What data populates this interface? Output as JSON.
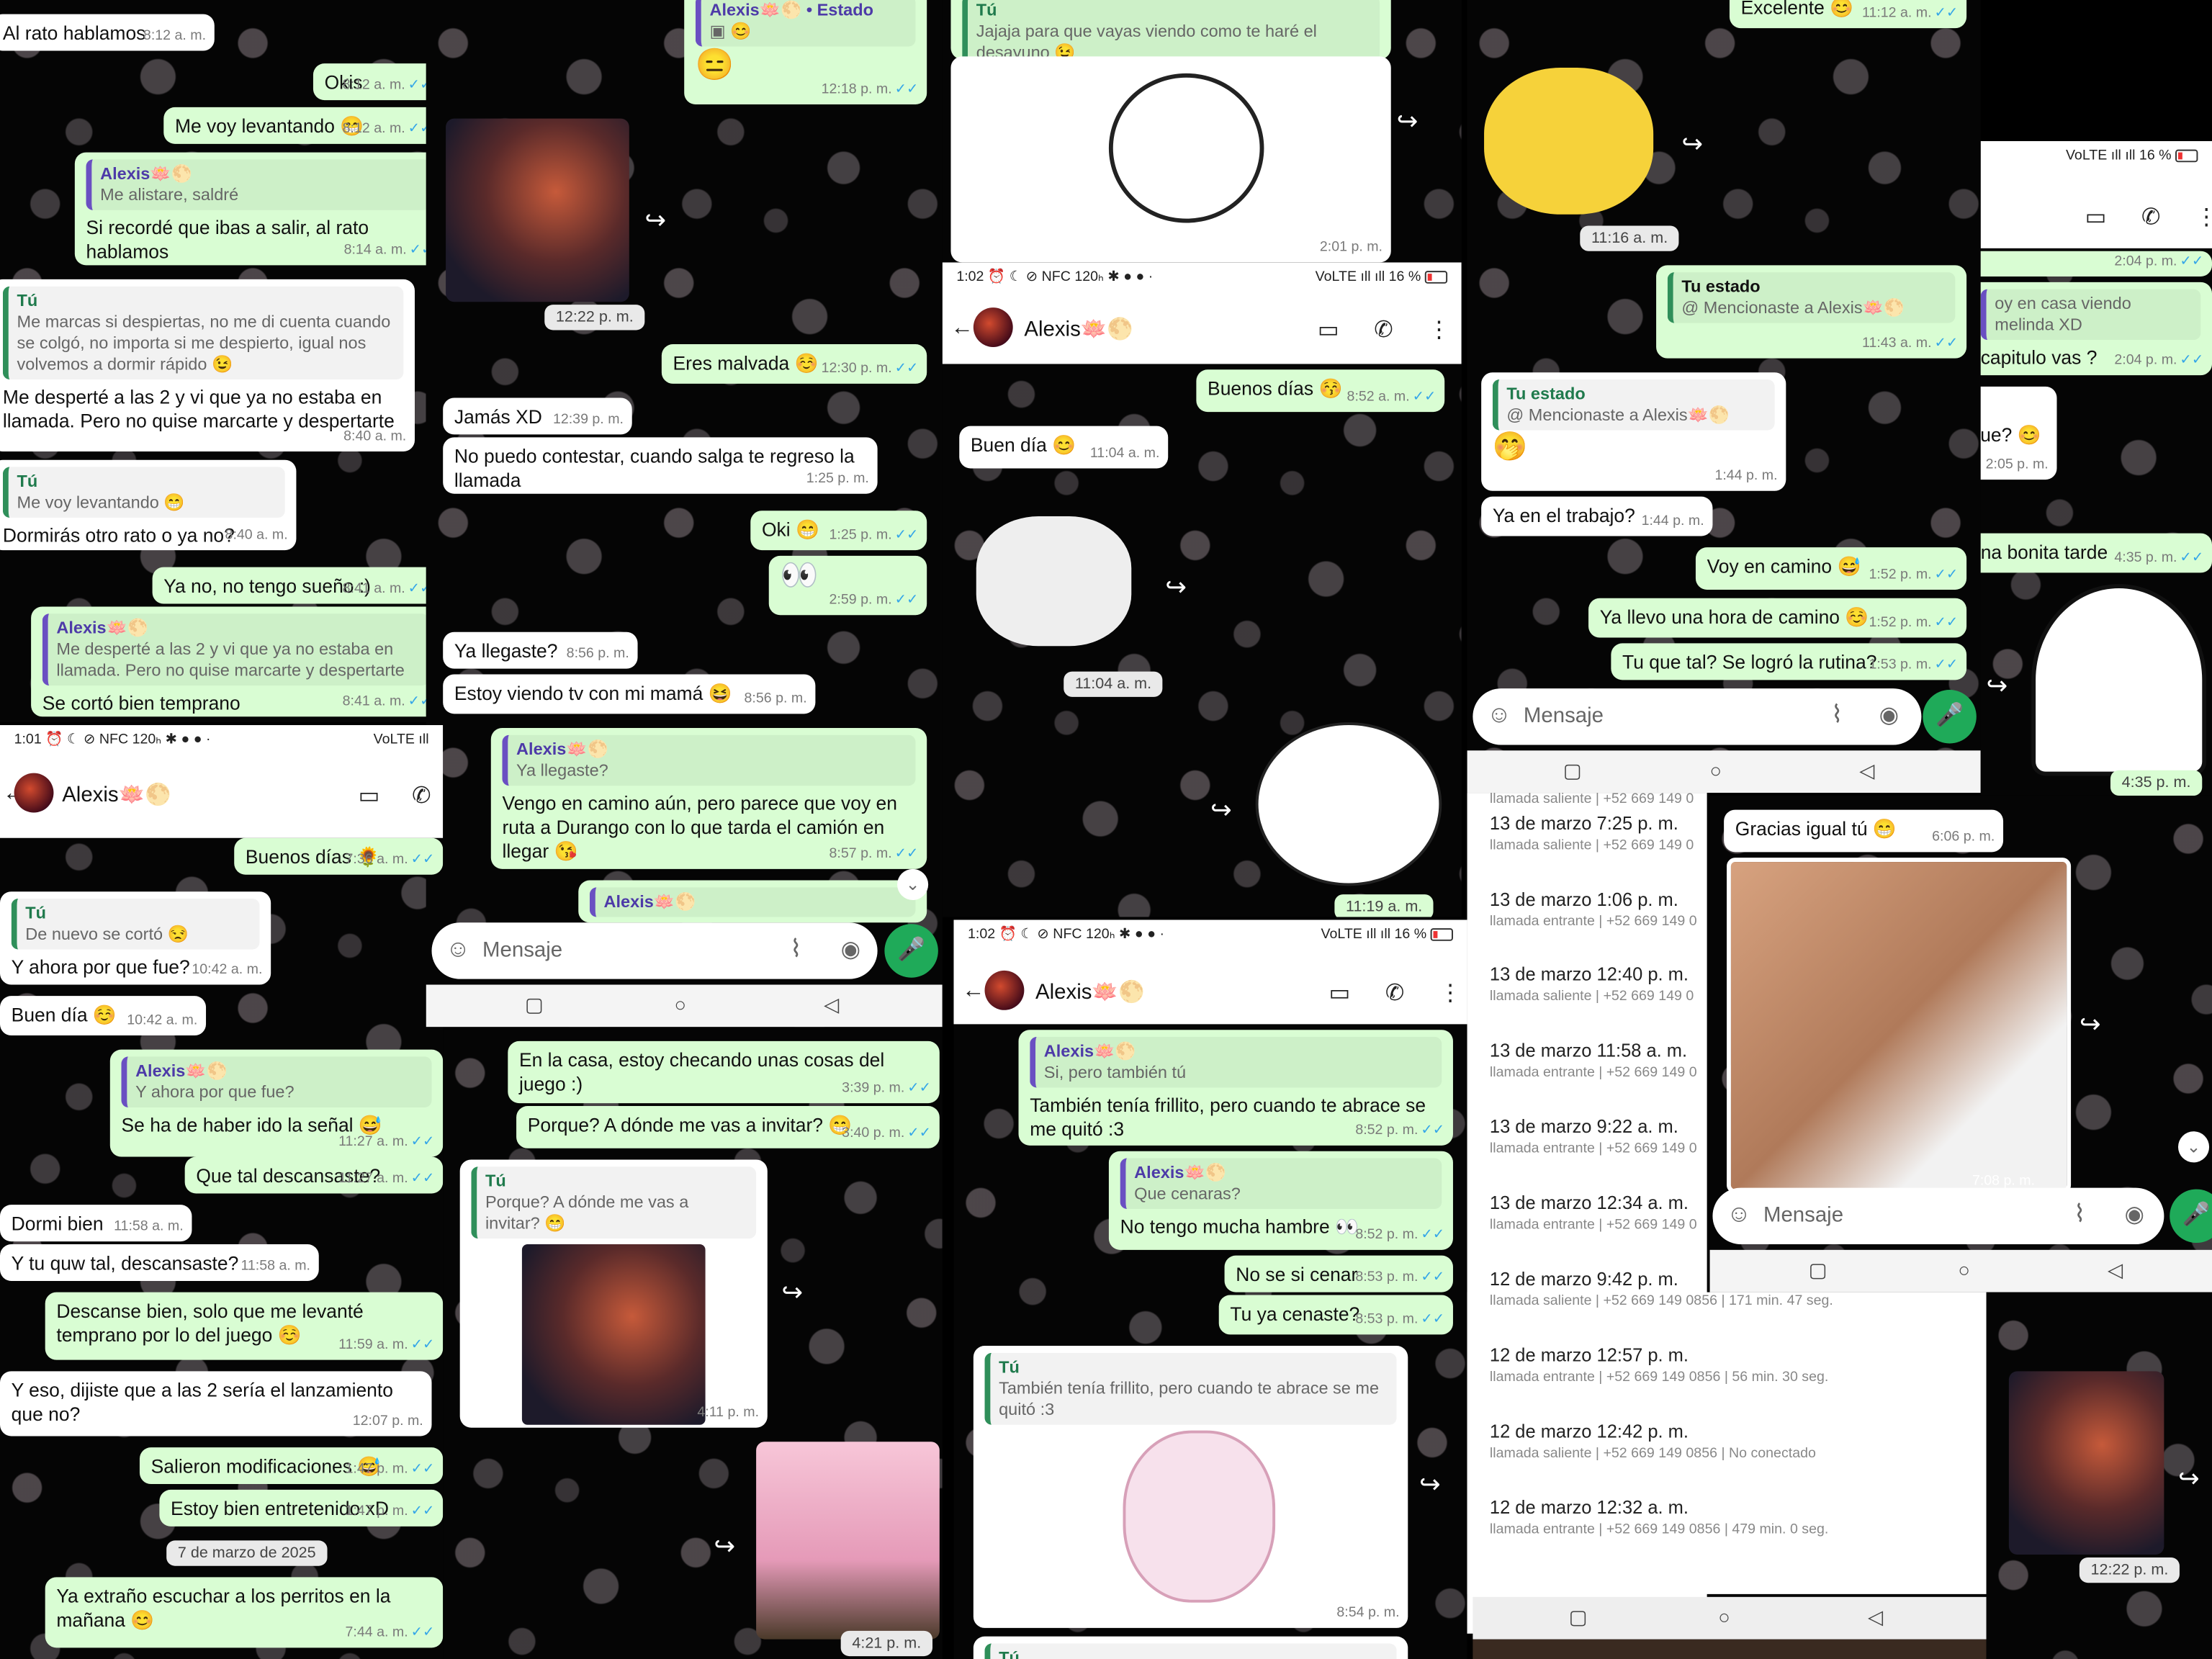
{
  "common": {
    "contact_name": "Alexis🪷🌕",
    "you_label": "Tú",
    "input_placeholder": "Mensaje",
    "status_label": "Tu estado",
    "mention_text": "@ Mencionaste a Alexis🪷🌕",
    "alexis_status_label": "Alexis🪷🌕 • Estado"
  },
  "status_bar": {
    "time_1": "1:01",
    "time_2": "1:02",
    "time_3": "1:02",
    "icons": "⏰ ☾ ⊘ NFC 120ₕ ✱ ● ● ·",
    "right": "VoLTE ıll ıll 16 %",
    "right_short": "VoLTE ıll"
  },
  "col1": {
    "m1": {
      "text": "Al rato hablamos",
      "time": "8:12 a. m."
    },
    "m2": {
      "text": "Okis",
      "time": "8:12 a. m."
    },
    "m3": {
      "text": "Me voy levantando 😁",
      "time": "8:12 a. m."
    },
    "m4": {
      "qname": "Alexis🪷🌕",
      "qtext": "Me alistare, saldré",
      "text": "Si recordé que ibas a salir, al rato hablamos",
      "time": "8:14 a. m."
    },
    "m5": {
      "qname": "Tú",
      "qtext": "Me marcas si despiertas, no me di cuenta cuando se colgó, no importa si me despierto, igual nos volvemos a dormir rápido 😉",
      "text": "Me desperté a las 2 y vi que ya no estaba en llamada. Pero no quise marcarte y despertarte",
      "time": "8:40 a. m."
    },
    "m6": {
      "qname": "Tú",
      "qtext": "Me voy levantando 😁",
      "text": "Dormirás otro rato o ya no?",
      "time": "8:40 a. m."
    },
    "m7": {
      "text": "Ya no, no tengo sueño :)",
      "time": "8:41 a. m."
    },
    "m8": {
      "qname": "Alexis🪷🌕",
      "qtext": "Me desperté a las 2 y vi que ya no estaba en llamada. Pero no quise marcarte y despertarte",
      "text": "Se cortó bien temprano",
      "time": "8:41 a. m."
    },
    "m9": {
      "text": "Buenos días 🌻",
      "time": "7:36 a. m."
    },
    "m10": {
      "qname": "Tú",
      "qtext": "De nuevo se cortó 😒",
      "text": "Y ahora por que fue?",
      "time": "10:42 a. m."
    },
    "m11": {
      "text": "Buen día ☺️",
      "time": "10:42 a. m."
    },
    "m12": {
      "qname": "Alexis🪷🌕",
      "qtext": "Y ahora por que fue?",
      "text": "Se ha de haber ido la señal 😅",
      "time": "11:27 a. m."
    },
    "m13": {
      "text": "Que tal descansaste?",
      "time": "11:27 a. m."
    },
    "m14": {
      "text": "Dormi bien",
      "time": "11:58 a. m."
    },
    "m15": {
      "text": "Y tu quw tal, descansaste?",
      "time": "11:58 a. m."
    },
    "m16": {
      "text": "Descanse bien, solo que me levanté temprano por lo del juego ☺️",
      "time": "11:59 a. m."
    },
    "m17": {
      "text": "Y eso, dijiste que a las 2 sería el lanzamiento que no?",
      "time": "12:07 p. m."
    },
    "m18": {
      "text": "Salieron modificaciones 😅",
      "time": "1:47 p. m."
    },
    "m19": {
      "text": "Estoy bien entretenido xD",
      "time": "1:47 p. m."
    },
    "date_chip": "7 de marzo de 2025",
    "m20": {
      "text": "Ya extraño escuchar a los perritos en la mañana 😊",
      "time": "7:44 a. m."
    }
  },
  "col2": {
    "top_time": "12:18 p. m.",
    "img_time": "12:22 p. m.",
    "m1": {
      "text": "Eres malvada ☺️",
      "time": "12:30 p. m."
    },
    "m2": {
      "text": "Jamás XD",
      "time": "12:39 p. m."
    },
    "m3": {
      "text": "No puedo contestar, cuando salga te regreso la llamada",
      "time": "1:25 p. m."
    },
    "m4": {
      "text": "Oki 😁",
      "time": "1:25 p. m."
    },
    "m5": {
      "text": "👀",
      "time": "2:59 p. m."
    },
    "m6": {
      "text": "Ya llegaste?",
      "time": "8:56 p. m."
    },
    "m7": {
      "text": "Estoy viendo tv con mi mamá 😆",
      "time": "8:56 p. m."
    },
    "m8": {
      "qname": "Alexis🪷🌕",
      "qtext": "Ya llegaste?",
      "text": "Vengo en camino aún, pero parece que voy en ruta a Durango con lo que tarda el camión en llegar 😘",
      "time": "8:57 p. m."
    },
    "m9": {
      "text": "En la casa, estoy checando unas cosas del juego :)",
      "time": "3:39 p. m."
    },
    "m10": {
      "text": "Porque? A dónde me vas a invitar? 😁",
      "time": "3:40 p. m."
    },
    "m11": {
      "qname": "Tú",
      "qtext": "Porque? A dónde me vas a invitar? 😁",
      "time": "4:11 p. m."
    },
    "m12_time": "4:21 p. m."
  },
  "col3": {
    "m1": {
      "qname": "Tú",
      "qtext": "Jajaja para que vayas viendo como te haré el desayuno 😉",
      "time": "2:01 p. m."
    },
    "m2": {
      "text": "Buenos días 😚",
      "time": "8:52 a. m."
    },
    "m3": {
      "text": "Buen día 😊",
      "time": "11:04 a. m."
    },
    "sticker_time": "11:04 a. m.",
    "sticker2_time": "11:19 a. m.",
    "m4": {
      "qname": "Alexis🪷🌕",
      "qtext": "Si, pero también tú",
      "text": "También tenía frillito, pero cuando te abrace se me quitó :3",
      "time": "8:52 p. m."
    },
    "m5": {
      "qname": "Alexis🪷🌕",
      "qtext": "Que cenaras?",
      "text": "No tengo mucha hambre 👀",
      "time": "8:52 p. m."
    },
    "m6": {
      "text": "No se si cenar",
      "time": "8:53 p. m."
    },
    "m7": {
      "text": "Tu ya cenaste?",
      "time": "8:53 p. m."
    },
    "m8": {
      "qname": "Tú",
      "qtext": "También tenía frillito, pero cuando te abrace se me quitó :3",
      "time": "8:54 p. m."
    }
  },
  "col4": {
    "m1": {
      "text": "Excelente 😊",
      "time": "11:12 a. m."
    },
    "pikachu_time": "11:16 a. m.",
    "m2_time": "11:43 a. m.",
    "m3_time": "1:44 p. m.",
    "m4": {
      "text": "Ya en el trabajo?",
      "time": "1:44 p. m."
    },
    "m5": {
      "text": "Voy en camino 😅",
      "time": "1:52 p. m."
    },
    "m6": {
      "text": "Ya llevo una hora de camino ☺️",
      "time": "1:52 p. m."
    },
    "m7": {
      "text": "Tu que tal? Se logró la rutina?",
      "time": "1:53 p. m."
    },
    "calls": [
      {
        "date": "13 de marzo 7:25 p. m.",
        "dir": "llamada saliente",
        "num": "+52 669 149 0"
      },
      {
        "date": "13 de marzo 1:06 p. m.",
        "dir": "llamada entrante",
        "num": "+52 669 149 0"
      },
      {
        "date": "13 de marzo 12:40 p. m.",
        "dir": "llamada saliente",
        "num": "+52 669 149 0"
      },
      {
        "date": "13 de marzo 11:58 a. m.",
        "dir": "llamada entrante",
        "num": "+52 669 149 0"
      },
      {
        "date": "13 de marzo 9:22 a. m.",
        "dir": "llamada entrante",
        "num": "+52 669 149 0"
      },
      {
        "date": "13 de marzo 12:34 a. m.",
        "dir": "llamada entrante",
        "num": "+52 669 149 0"
      },
      {
        "date": "12 de marzo 9:42 p. m.",
        "dir": "llamada saliente",
        "num": "+52 669 149 0856",
        "dur": "171 min. 47 seg."
      },
      {
        "date": "12 de marzo 12:57 p. m.",
        "dir": "llamada entrante",
        "num": "+52 669 149 0856",
        "dur": "56 min. 30 seg."
      },
      {
        "date": "12 de marzo 12:42 p. m.",
        "dir": "llamada saliente",
        "num": "+52 669 149 0856",
        "dur": "No conectado"
      },
      {
        "date": "12 de marzo 12:32 a. m.",
        "dir": "llamada entrante",
        "num": "+52 669 149 0856",
        "dur": "479 min. 0 seg."
      }
    ],
    "calls_top": {
      "dir": "llamada saliente",
      "num": "+52 669 149 0"
    }
  },
  "col5": {
    "m1_time": "2:04 p. m.",
    "m2": {
      "qtext": "oy en casa viendo melinda XD",
      "text": "capitulo vas ?",
      "time": "2:04 p. m."
    },
    "m3": {
      "text": "fue? 😊",
      "time": "2:05 p. m."
    },
    "m4": {
      "text": "na bonita tarde",
      "time": "4:35 p. m."
    },
    "sticker_time": "4:35 p. m.",
    "m5": {
      "text": "Gracias igual tú 😁",
      "time": "6:06 p. m."
    },
    "photo_time": "7:08 p. m.",
    "last_time": "12:22 p. m."
  }
}
